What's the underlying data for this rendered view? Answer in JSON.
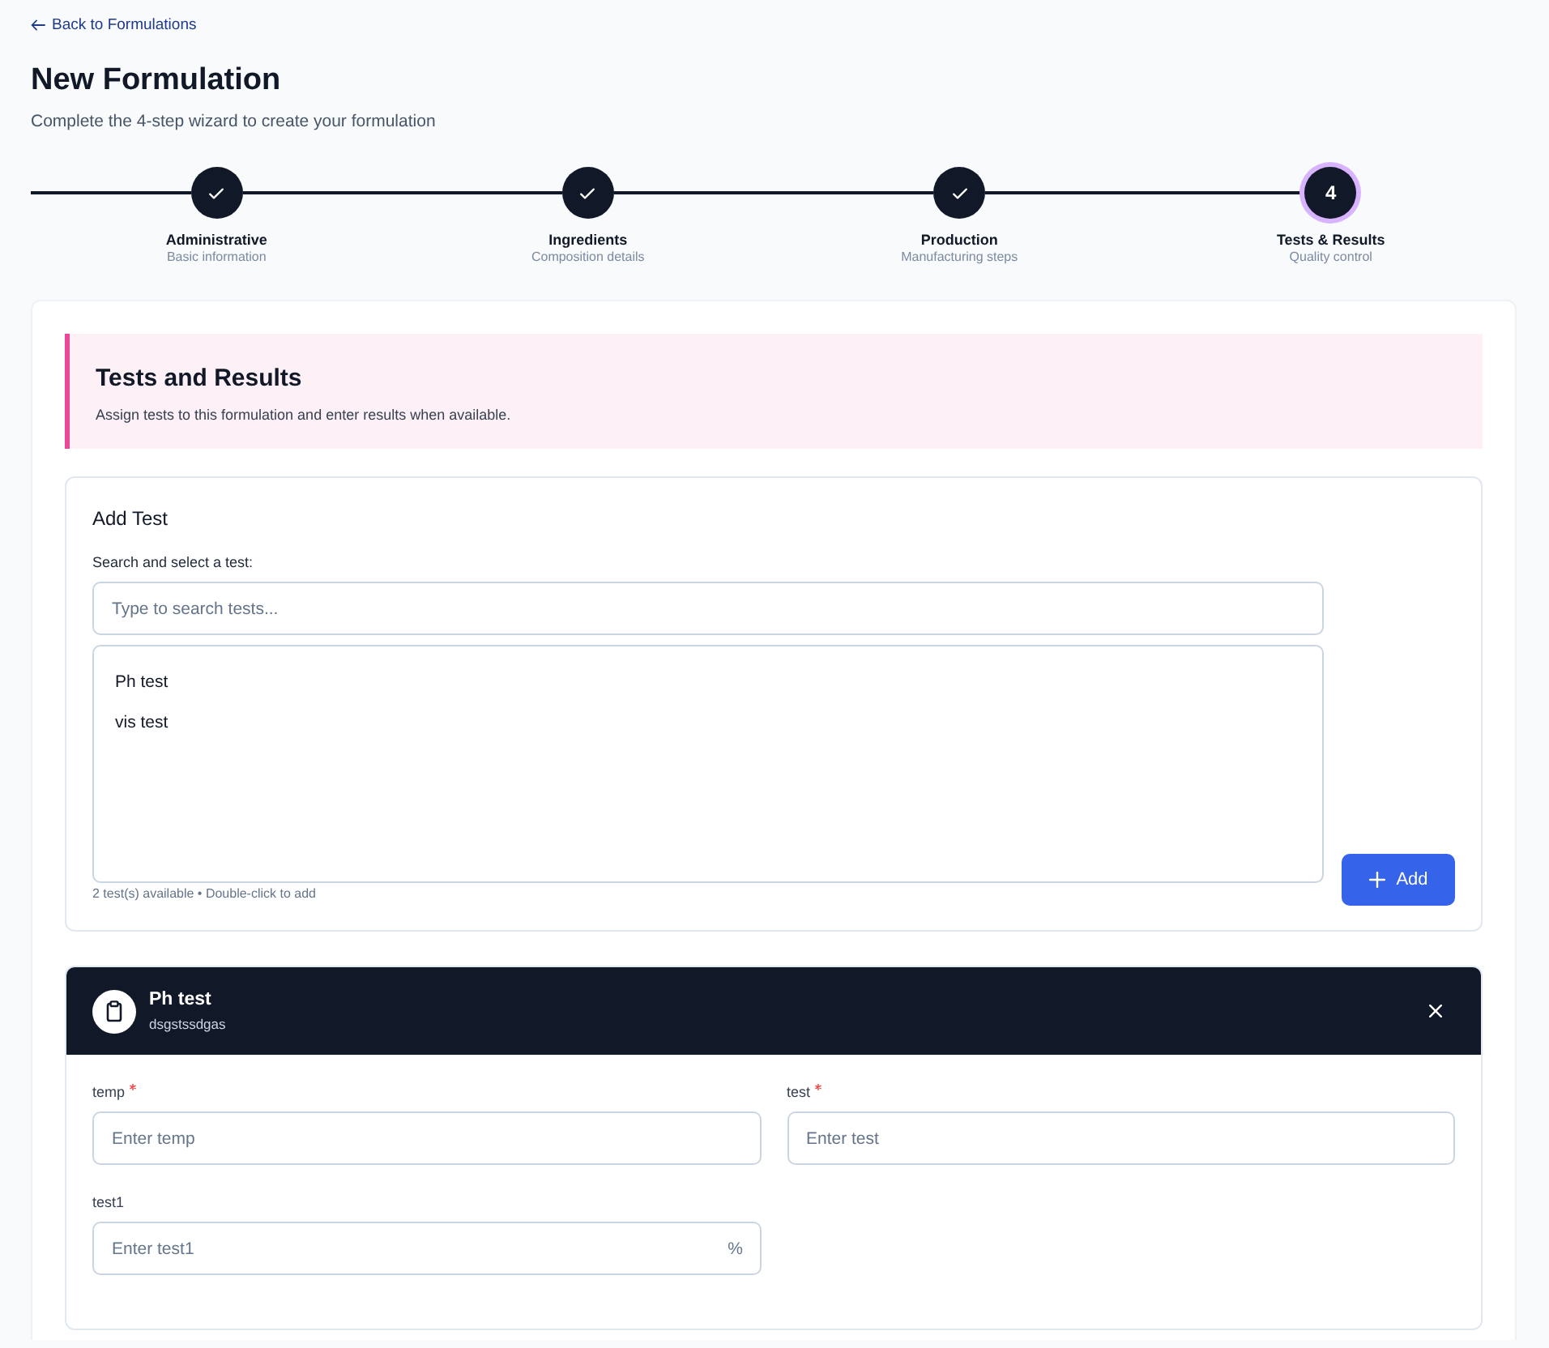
{
  "back_link": {
    "label": "Back to Formulations"
  },
  "header": {
    "title": "New Formulation",
    "subtitle": "Complete the 4-step wizard to create your formulation"
  },
  "steps": [
    {
      "title": "Administrative",
      "subtitle": "Basic information",
      "completed": true,
      "selected": false
    },
    {
      "title": "Ingredients",
      "subtitle": "Composition details",
      "completed": true,
      "selected": false
    },
    {
      "title": "Production",
      "subtitle": "Manufacturing steps",
      "completed": true,
      "selected": false
    },
    {
      "number": "4",
      "title": "Tests & Results",
      "subtitle": "Quality control",
      "completed": false,
      "selected": true
    }
  ],
  "section": {
    "title": "Tests and Results",
    "description": "Assign tests to this formulation and enter results when available."
  },
  "add_test": {
    "title": "Add Test",
    "search_label": "Search and select a test:",
    "search": {
      "placeholder": "Type to search tests..."
    },
    "options": [
      {
        "label": "Ph test",
        "selected": false
      },
      {
        "label": "vis test",
        "selected": false
      }
    ],
    "hint": "2 test(s) available • Double-click to add",
    "button": {
      "label": "Add"
    }
  },
  "tests": [
    {
      "title": "Ph test",
      "subtitle": "dsgstssdgas",
      "fields": [
        {
          "label": "temp",
          "required": true,
          "placeholder": "Enter temp"
        },
        {
          "label": "test",
          "required": true,
          "placeholder": "Enter test"
        },
        {
          "label": "test1",
          "required": false,
          "placeholder": "Enter test1",
          "suffix": "%"
        }
      ]
    }
  ]
}
